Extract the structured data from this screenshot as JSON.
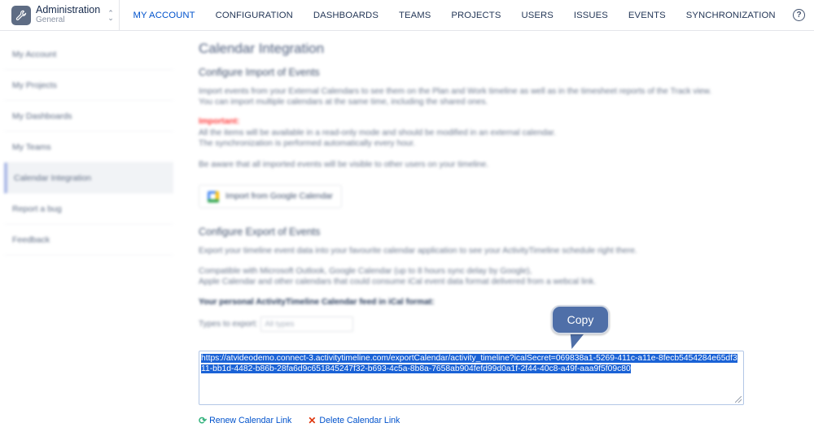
{
  "header": {
    "app_title": "Administration",
    "app_subtitle": "General",
    "app_icon": "wrench-icon",
    "nav": [
      {
        "label": "MY ACCOUNT",
        "active": true
      },
      {
        "label": "CONFIGURATION"
      },
      {
        "label": "DASHBOARDS"
      },
      {
        "label": "TEAMS"
      },
      {
        "label": "PROJECTS"
      },
      {
        "label": "USERS"
      },
      {
        "label": "ISSUES"
      },
      {
        "label": "EVENTS"
      },
      {
        "label": "SYNCHRONIZATION"
      }
    ],
    "help_label": "?"
  },
  "sidebar": {
    "items": [
      {
        "label": "My Account"
      },
      {
        "label": "My Projects"
      },
      {
        "label": "My Dashboards"
      },
      {
        "label": "My Teams"
      },
      {
        "label": "Calendar Integration",
        "active": true
      },
      {
        "label": "Report a bug"
      },
      {
        "label": "Feedback"
      }
    ]
  },
  "main": {
    "title": "Calendar Integration",
    "import": {
      "heading": "Configure Import of Events",
      "para1_line1": "Import events from your External Calendars to see them on the Plan and Work timeline as well as in the timesheet reports of the Track view.",
      "para1_line2": "You can import multiple calendars at the same time, including the shared ones.",
      "important_label": "Important:",
      "important_line1": "All the items will be available in a read-only mode and should be modified in an external calendar.",
      "important_line2": "The synchronization is performed automatically every hour.",
      "aware": "Be aware that all imported events will be visible to other users on your timeline.",
      "google_button": "Import from Google Calendar"
    },
    "export": {
      "heading": "Configure Export of Events",
      "para1": "Export your timeline event data into your favourite calendar application to see your ActivityTimeline schedule right there.",
      "compat_line1": "Compatible with Microsoft Outlook, Google Calendar (up to 8 hours sync delay by Google),",
      "compat_line2": "Apple Calendar and other calendars that could consume iCal event data format delivered from a webcal link.",
      "feed_label": "Your personal ActivityTimeline Calendar feed in iCal format:",
      "types_label": "Types to export:",
      "types_placeholder": "All types",
      "feed_url": "https://atvideodemo.connect-3.activitytimeline.com/exportCalendar/activity_timeline?icalSecret=069838a1-5269-411c-a11e-8fecb5454284e65df311-bb1d-4482-b86b-28fa6d9c651845247f32-b693-4c5a-8b8a-7658ab904fefd99d0a1f-2f44-40c8-a49f-aaa9f5f09c80",
      "copy_callout": "Copy",
      "renew_link": "Renew Calendar Link",
      "delete_link": "Delete Calendar Link"
    }
  },
  "colors": {
    "accent": "#0052cc",
    "important": "#ff3a3a",
    "selection": "#1a62d6",
    "callout": "#4f6fa8",
    "renew_icon": "#36b37e",
    "delete_icon": "#de350b"
  }
}
